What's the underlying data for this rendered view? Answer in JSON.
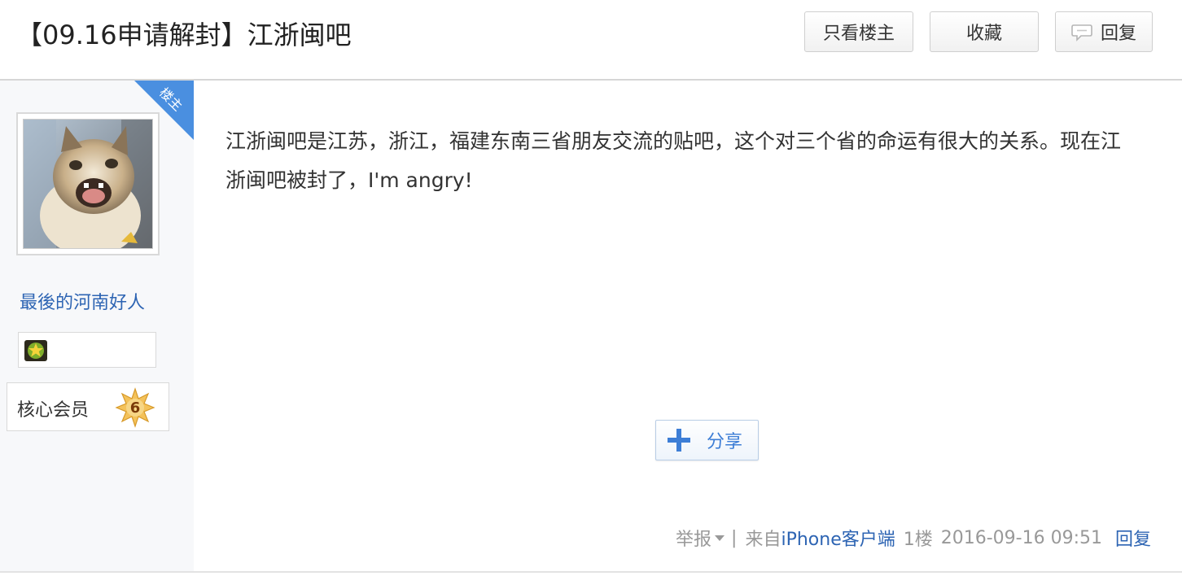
{
  "header": {
    "title": "【09.16申请解封】江浙闽吧",
    "btn_only_owner": "只看楼主",
    "btn_favorite": "收藏",
    "btn_reply": "回复"
  },
  "author": {
    "owner_tag": "楼主",
    "username": "最後的河南好人",
    "level_title": "核心会员",
    "level_num": "6"
  },
  "post": {
    "content": "江浙闽吧是江苏，浙江，福建东南三省朋友交流的贴吧，这个对三个省的命运有很大的关系。现在江浙闽吧被封了，I'm angry!",
    "share_label": "分享"
  },
  "footer": {
    "report": "举报",
    "separator": "|",
    "from_prefix": "来自",
    "client": "iPhone客户端",
    "floor": "1楼",
    "datetime": "2016-09-16 09:51",
    "reply": "回复"
  },
  "colors": {
    "link_blue": "#2d64b3",
    "ribbon_blue": "#4a8fe0",
    "muted_gray": "#999999"
  }
}
